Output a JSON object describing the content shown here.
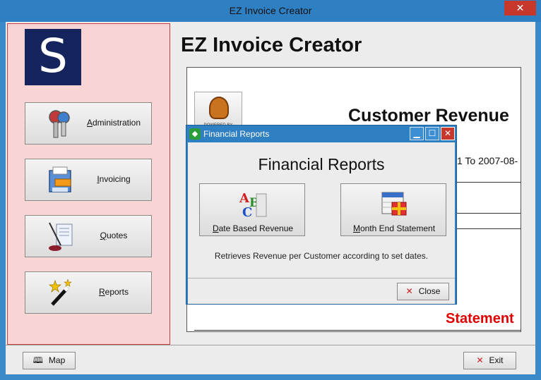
{
  "window": {
    "title": "EZ Invoice Creator",
    "close_glyph": "✕"
  },
  "nav": {
    "logo_letter": "S",
    "items": [
      {
        "label": "Administration",
        "icon": "keys-icon"
      },
      {
        "label": "Invoicing",
        "icon": "printer-icon"
      },
      {
        "label": "Quotes",
        "icon": "quill-document-icon"
      },
      {
        "label": "Reports",
        "icon": "magic-wand-icon"
      }
    ]
  },
  "main": {
    "app_title": "EZ Invoice Creator",
    "report": {
      "powered_by": "POWERED BY",
      "title": "Customer Revenue",
      "date_range": "1 To 2007-08-",
      "statement": "Statement"
    }
  },
  "bottom": {
    "map_label": "Map",
    "exit_label": "Exit"
  },
  "dialog": {
    "title": "Financial Reports",
    "heading": "Financial Reports",
    "buttons": [
      {
        "label": "Date Based Revenue",
        "icon": "abc-blocks-icon"
      },
      {
        "label": "Month End Statement",
        "icon": "calendar-gift-icon"
      }
    ],
    "description": "Retrieves Revenue per Customer according to set dates.",
    "close_label": "Close",
    "min_glyph": "▁",
    "max_glyph": "☐",
    "close_glyph": "✕"
  },
  "colors": {
    "title_bar": "#2f7fc3",
    "nav_bg": "#f9d4d4",
    "statement_red": "#e00000",
    "logo_bg": "#15245c"
  }
}
